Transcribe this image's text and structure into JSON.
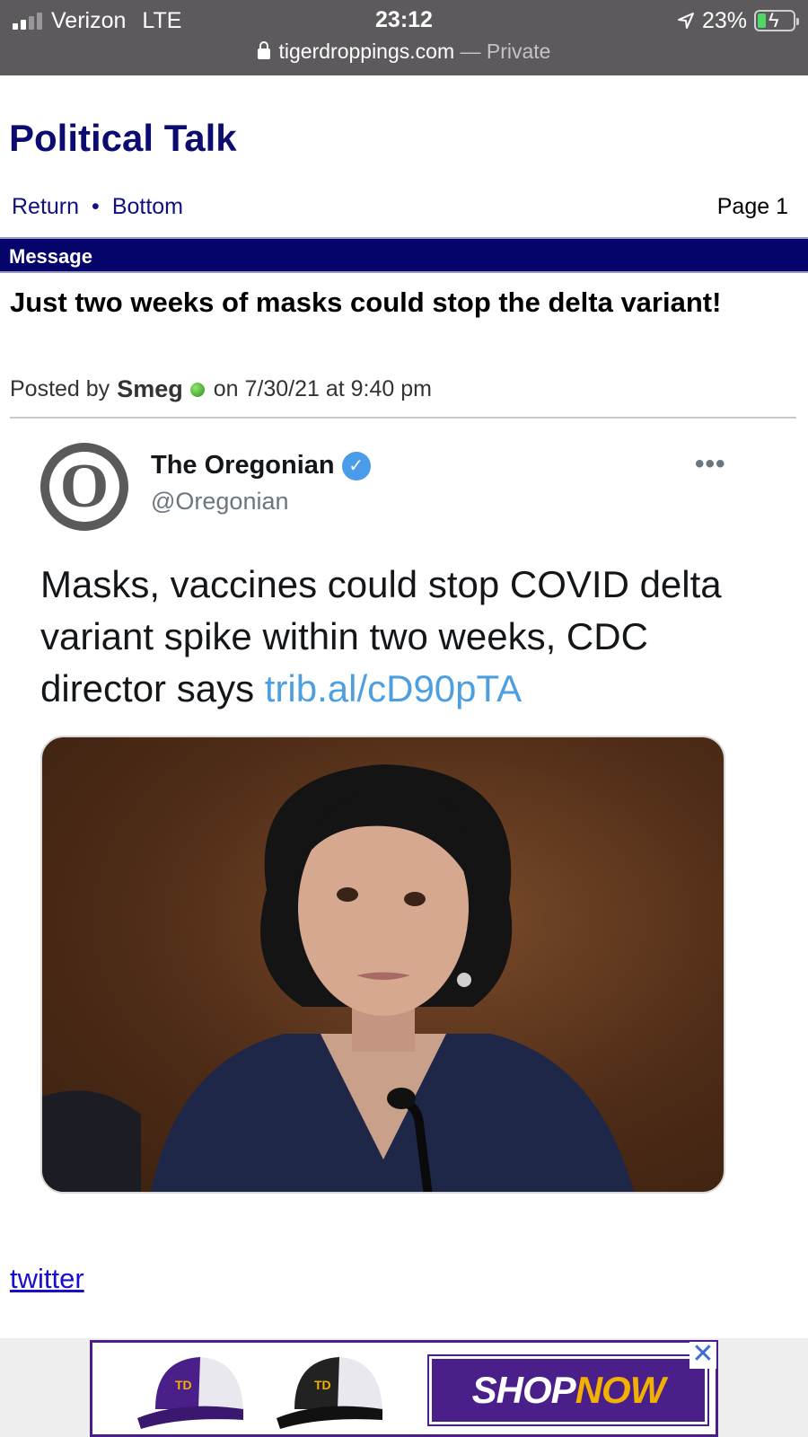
{
  "status_bar": {
    "carrier": "Verizon",
    "network": "LTE",
    "time": "23:12",
    "battery": "23%",
    "url": "tigerdroppings.com",
    "url_suffix": "— Private"
  },
  "header": {
    "title": "Political Talk",
    "nav": {
      "return": "Return",
      "separator": "•",
      "bottom": "Bottom"
    },
    "page": "Page 1"
  },
  "message_bar": {
    "label": "Message"
  },
  "post": {
    "title": "Just two weeks of masks could stop the delta variant!",
    "posted_prefix": "Posted by",
    "author": "Smeg",
    "posted_suffix": "on 7/30/21 at 9:40 pm"
  },
  "tweet": {
    "avatar_letter": "O",
    "name": "The Oregonian",
    "handle": "@Oregonian",
    "more": "•••",
    "text": "Masks, vaccines could stop COVID delta variant spike within two weeks, CDC director says ",
    "link": "trib.al/cD90pTA"
  },
  "footer": {
    "twitter_link": "twitter"
  },
  "ad": {
    "close": "✕",
    "shop_a": "SHOP",
    "shop_b": "NOW",
    "hat_mark": "TD",
    "colors": {
      "brand_purple": "#4b1f8a",
      "brand_gold": "#f2b100"
    }
  }
}
